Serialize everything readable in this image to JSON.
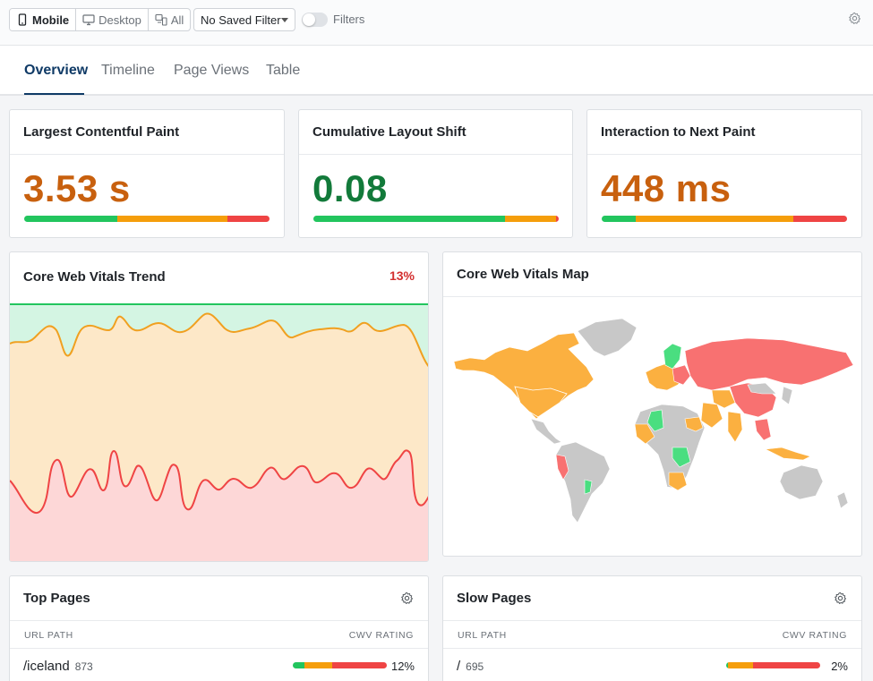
{
  "toolbar": {
    "devices": [
      {
        "label": "Mobile",
        "icon": "mobile-icon",
        "active": true
      },
      {
        "label": "Desktop",
        "icon": "desktop-icon",
        "active": false
      },
      {
        "label": "All",
        "icon": "devices-icon",
        "active": false
      }
    ],
    "saved_filter": "No Saved Filter",
    "filters_label": "Filters",
    "filters_enabled": false
  },
  "tabs": [
    "Overview",
    "Timeline",
    "Page Views",
    "Table"
  ],
  "active_tab": "Overview",
  "metrics": [
    {
      "title": "Largest Contentful Paint",
      "value": "3.53 s",
      "color": "#c8600e",
      "distribution": {
        "good": 38,
        "needs_improvement": 45,
        "poor": 17
      }
    },
    {
      "title": "Cumulative Layout Shift",
      "value": "0.08",
      "color": "#127a3a",
      "distribution": {
        "good": 78,
        "needs_improvement": 21,
        "poor": 1
      }
    },
    {
      "title": "Interaction to Next Paint",
      "value": "448 ms",
      "color": "#c8600e",
      "distribution": {
        "good": 14,
        "needs_improvement": 64,
        "poor": 22
      }
    }
  ],
  "trend": {
    "title": "Core Web Vitals Trend",
    "percent": "13%"
  },
  "map": {
    "title": "Core Web Vitals Map"
  },
  "top_pages": {
    "title": "Top Pages",
    "col_path": "URL PATH",
    "col_rating": "CWV RATING",
    "rows": [
      {
        "path": "/iceland",
        "count": "873",
        "pct": "12%",
        "distribution": {
          "good": 12,
          "needs_improvement": 30,
          "poor": 58
        }
      }
    ]
  },
  "slow_pages": {
    "title": "Slow Pages",
    "col_path": "URL PATH",
    "col_rating": "CWV RATING",
    "rows": [
      {
        "path": "/",
        "count": "695",
        "pct": "2%",
        "distribution": {
          "good": 2,
          "needs_improvement": 27,
          "poor": 71
        }
      }
    ]
  },
  "colors": {
    "good": "#22c55e",
    "needs_improvement": "#f59e0b",
    "poor": "#ef4444",
    "map_poor": "#f87171",
    "map_ni": "#fbb040",
    "map_good": "#4ade80",
    "map_none": "#c8c8c8",
    "accent": "#0f3a66"
  }
}
